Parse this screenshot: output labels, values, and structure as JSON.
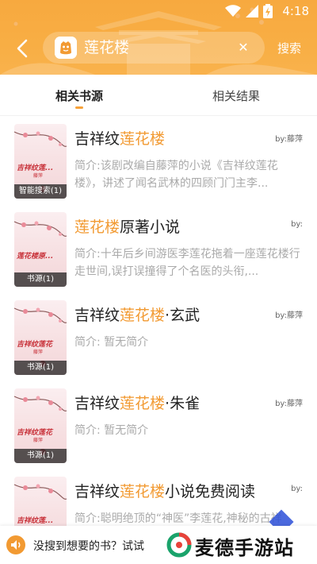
{
  "status_bar": {
    "time": "4:18"
  },
  "search": {
    "query": "莲花楼",
    "button_label": "搜索"
  },
  "tabs": [
    {
      "label": "相关书源"
    },
    {
      "label": "相关结果"
    }
  ],
  "results": [
    {
      "title_pre": "吉祥纹",
      "title_hl": "莲花楼",
      "title_post": "",
      "author": "by:藤萍",
      "desc": "简介:该剧改编自藤萍的小说《吉祥纹莲花楼》，讲述了闻名武林的四顾门门主李...",
      "cover_title": "吉祥纹莲...",
      "cover_sub": "藤萍",
      "badge": "智能搜索(1)"
    },
    {
      "title_pre": "",
      "title_hl": "莲花楼",
      "title_post": "原著小说",
      "author": "by:",
      "desc": "简介:十年后乡间游医李莲花拖着一座莲花楼行走世间,误打误撞得了个名医的头衔,...",
      "cover_title": "莲花楼原...",
      "cover_sub": "",
      "badge": "书源(1)"
    },
    {
      "title_pre": "吉祥纹",
      "title_hl": "莲花楼",
      "title_post": "·玄武",
      "author": "by:藤萍",
      "desc": "简介: 暂无简介",
      "cover_title": "吉祥纹莲花",
      "cover_sub": "藤萍",
      "badge": "书源(1)"
    },
    {
      "title_pre": "吉祥纹",
      "title_hl": "莲花楼",
      "title_post": "·朱雀",
      "author": "by:藤萍",
      "desc": "简介: 暂无简介",
      "cover_title": "吉祥纹莲花",
      "cover_sub": "藤萍",
      "badge": "书源(1)"
    },
    {
      "title_pre": "吉祥纹",
      "title_hl": "莲花楼",
      "title_post": "小说免费阅读",
      "author": "by:",
      "desc": "简介:聪明绝顶的“神医”李莲花,神秘的古祥",
      "cover_title": "吉祥纹莲...",
      "cover_sub": "",
      "badge": ""
    }
  ],
  "bottom_bar": {
    "text": "没搜到想要的书？试试",
    "watermark": "麦德手游站"
  },
  "colors": {
    "accent": "#f7a23a",
    "highlight": "#f29a32",
    "header": "#f8ae44"
  },
  "icons": [
    "wifi-icon",
    "signal-icon",
    "battery-icon",
    "back-arrow-icon",
    "app-logo-icon",
    "clear-icon",
    "speaker-icon",
    "watermark-logo-icon"
  ]
}
